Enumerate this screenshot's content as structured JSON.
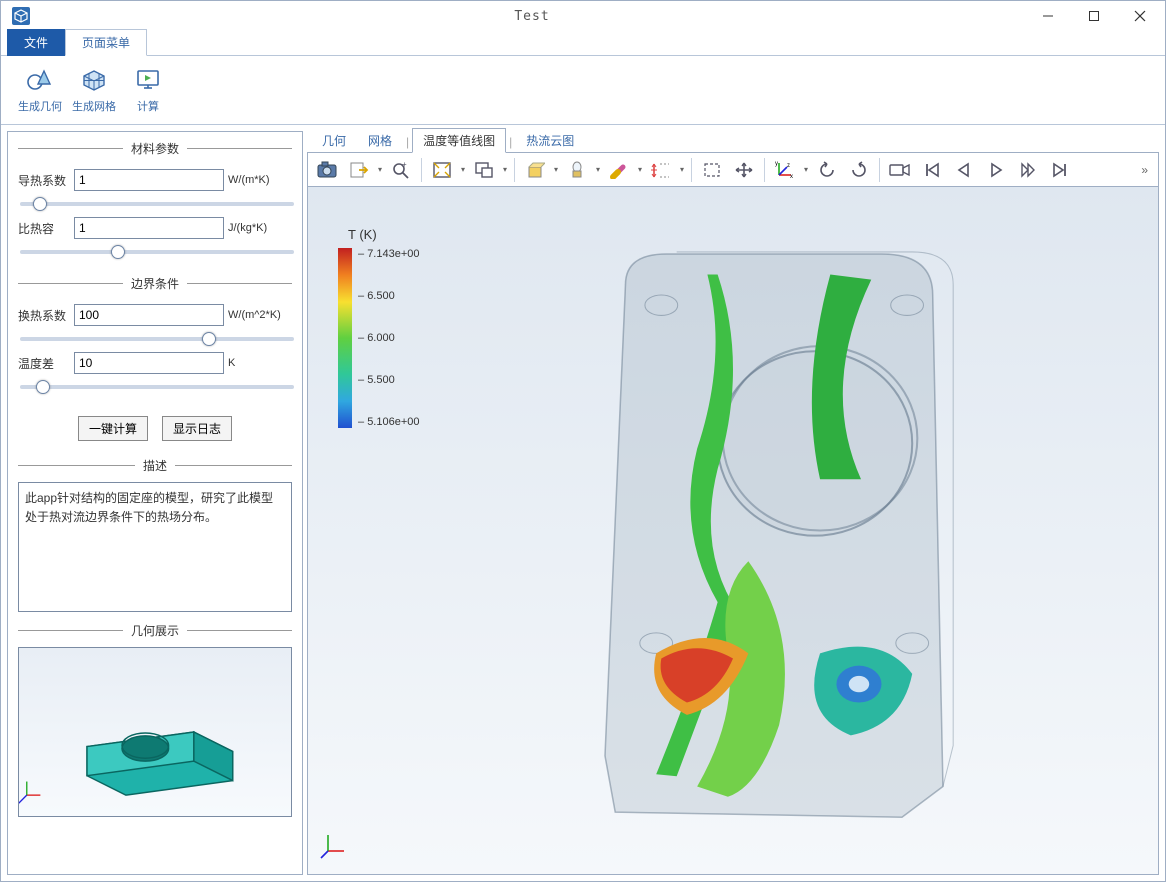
{
  "title": "Test",
  "menuTabs": {
    "file": "文件",
    "page": "页面菜单"
  },
  "ribbon": {
    "genGeom": "生成几何",
    "genMesh": "生成网格",
    "compute": "计算"
  },
  "sections": {
    "material": "材料参数",
    "boundary": "边界条件",
    "description": "描述",
    "geomPreview": "几何展示"
  },
  "params": {
    "thermalCond": {
      "label": "导热系数",
      "value": "1",
      "unit": "W/(m*K)"
    },
    "heatCap": {
      "label": "比热容",
      "value": "1",
      "unit": "J/(kg*K)"
    },
    "convCoeff": {
      "label": "换热系数",
      "value": "100",
      "unit": "W/(m^2*K)"
    },
    "tempDiff": {
      "label": "温度差",
      "value": "10",
      "unit": "K"
    }
  },
  "buttons": {
    "oneKey": "一键计算",
    "showLog": "显示日志"
  },
  "descText": "此app针对结构的固定座的模型，研究了此模型处于热对流边界条件下的热场分布。",
  "viewTabs": {
    "geom": "几何",
    "mesh": "网格",
    "iso": "温度等值线图",
    "flux": "热流云图"
  },
  "legend": {
    "title": "T (K)",
    "ticks": [
      "7.143e+00",
      "6.500",
      "6.000",
      "5.500",
      "5.106e+00"
    ]
  },
  "toolbarMore": "»"
}
